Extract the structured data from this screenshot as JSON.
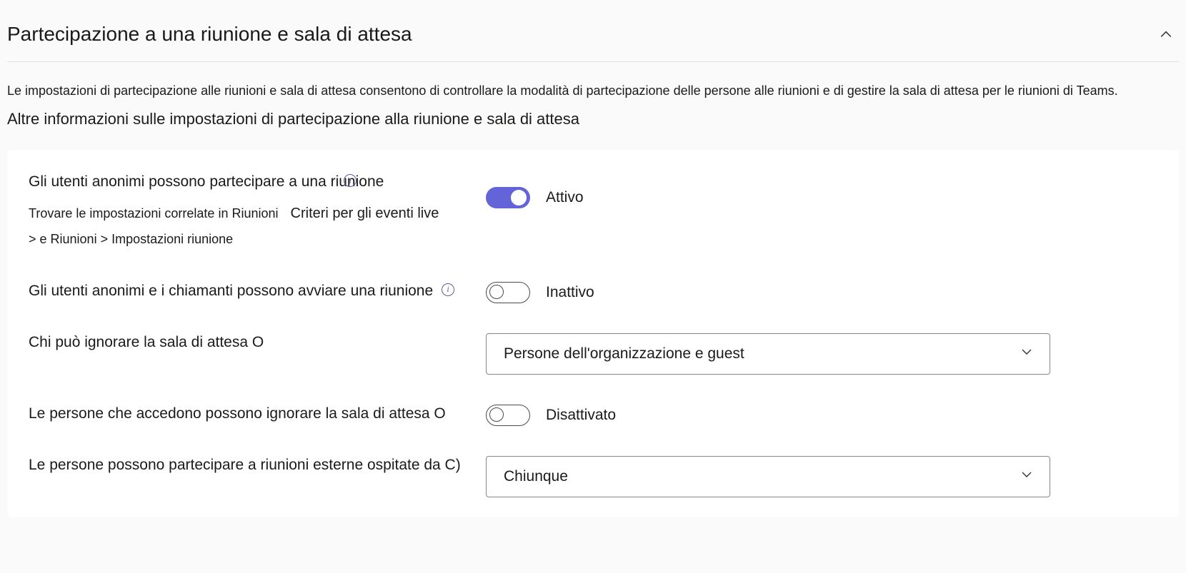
{
  "section": {
    "title": "Partecipazione a una riunione e sala di attesa",
    "description": "Le impostazioni di partecipazione alle riunioni e sala di attesa consentono di controllare la modalità di partecipazione delle persone alle riunioni e di gestire la sala di attesa per le riunioni di Teams.",
    "learn_more": "Altre informazioni sulle impostazioni di partecipazione alla riunione e sala di attesa"
  },
  "settings": {
    "anon_join": {
      "label": "Gli utenti anonimi possono partecipare a una riunione",
      "sub_prefix": "Trovare le impostazioni correlate in Riunioni",
      "sub_link": "Criteri per gli eventi live",
      "sub_rest": "&gt; e Riunioni &gt; Impostazioni riunione",
      "state_label": "Attivo",
      "state": true
    },
    "anon_start": {
      "label": "Gli utenti anonimi e i chiamanti possono avviare una riunione",
      "state_label": "Inattivo",
      "state": false
    },
    "bypass_lobby": {
      "label": "Chi può ignorare la sala di attesa O",
      "value": "Persone dell'organizzazione e guest"
    },
    "dialin_bypass": {
      "label": "Le persone che accedono possono ignorare la sala di attesa O",
      "state_label": "Disattivato",
      "state": false
    },
    "external_join": {
      "label": "Le persone possono partecipare a riunioni esterne ospitate da C)",
      "value": "Chiunque"
    }
  }
}
